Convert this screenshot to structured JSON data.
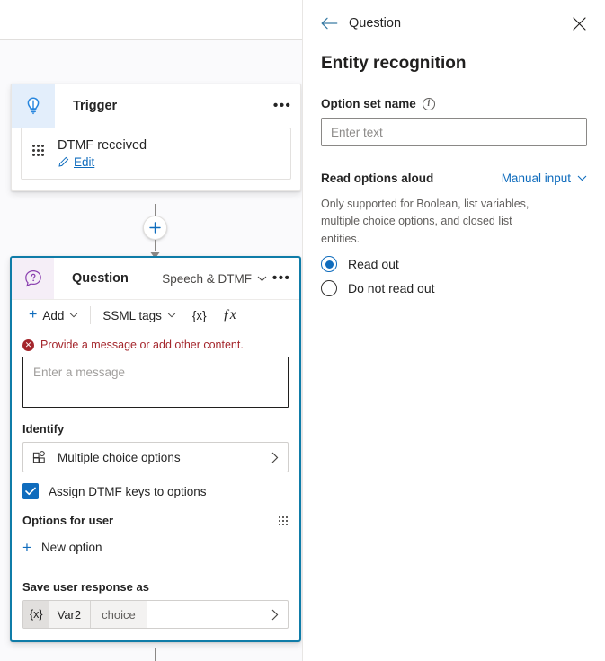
{
  "canvas": {
    "trigger_node": {
      "icon": "lightbulb-icon",
      "title": "Trigger",
      "overflow_label": "•••",
      "card": {
        "drag_icon": "drag-dots-icon",
        "title": "DTMF received",
        "edit_icon": "pencil-icon",
        "edit_label": "Edit"
      }
    },
    "add_node_button": "+",
    "question_node": {
      "icon": "question-bubble-icon",
      "title": "Question",
      "mode_label": "Speech & DTMF",
      "mode_caret": "chevron-down-icon",
      "overflow_label": "•••",
      "toolbar": {
        "add_label": "Add",
        "ssml_label": "SSML tags",
        "variable_label": "{x}",
        "formula_label": "ƒx"
      },
      "error_text": "Provide a message or add other content.",
      "message_placeholder": "Enter a message",
      "identify_label": "Identify",
      "identify_value": "Multiple choice options",
      "identify_icon": "layout-grid-icon",
      "checkbox_label": "Assign DTMF keys to options",
      "checkbox_checked": true,
      "options_header": "Options for user",
      "options_grip_icon": "grip-dots-icon",
      "new_option_label": "New option",
      "save_response_label": "Save user response as",
      "variable": {
        "token": "{x}",
        "name": "Var2",
        "type": "choice"
      }
    }
  },
  "panel": {
    "back_icon": "back-arrow-icon",
    "breadcrumb": "Question",
    "close_icon": "close-icon",
    "heading": "Entity recognition",
    "option_set_label": "Option set name",
    "option_set_info_icon": "info-icon",
    "option_set_placeholder": "Enter text",
    "read_aloud_label": "Read options aloud",
    "read_aloud_mode": "Manual input",
    "read_aloud_caret": "chevron-down-icon",
    "helper_text": "Only supported for Boolean, list variables, multiple choice options, and closed list entities.",
    "radios": [
      {
        "label": "Read out",
        "selected": true
      },
      {
        "label": "Do not read out",
        "selected": false
      }
    ]
  },
  "colors": {
    "accent": "#0f6cbd",
    "selected_border": "#0f7ca8",
    "error": "#a4262c",
    "trigger_icon_bg": "#e3eefb",
    "question_icon_bg": "#f5eef7"
  }
}
